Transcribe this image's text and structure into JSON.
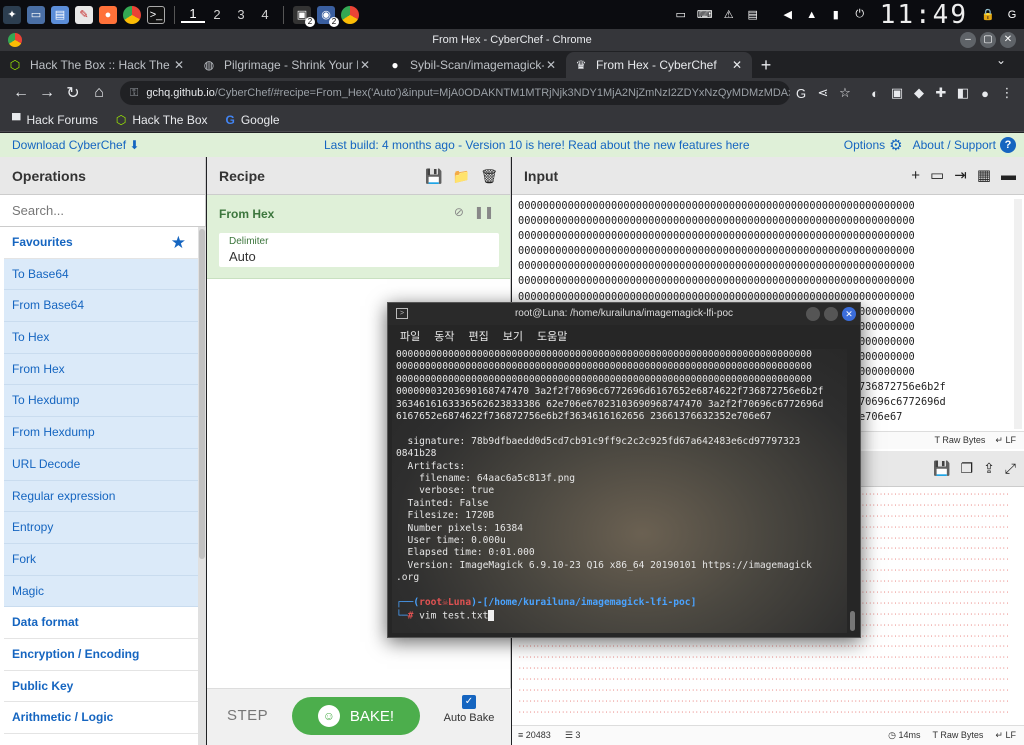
{
  "taskbar": {
    "workspaces": [
      "1",
      "2",
      "3",
      "4"
    ],
    "badge_count": "2",
    "clock": "11:49"
  },
  "window": {
    "title": "From Hex - CyberChef - Chrome"
  },
  "tabs": [
    {
      "label": "Hack The Box :: Hack The B"
    },
    {
      "label": "Pilgrimage - Shrink Your I"
    },
    {
      "label": "Sybil-Scan/imagemagick-l"
    },
    {
      "label": "From Hex - CyberChef"
    }
  ],
  "address": {
    "host": "gchq.github.io",
    "path": "/CyberChef/#recipe=From_Hex('Auto')&input=MjA0ODAKNTM1MTRjNjk3NDY1MjA2NjZmNzI2ZDYxNzQyMDMzMDAx..."
  },
  "bookmarks": [
    "Hack Forums",
    "Hack The Box",
    "Google"
  ],
  "banner": {
    "download": "Download CyberChef",
    "message": "Last build: 4 months ago - Version 10 is here! Read about the new features here",
    "options": "Options",
    "about": "About / Support"
  },
  "operations": {
    "title": "Operations",
    "search_placeholder": "Search...",
    "favourites": "Favourites",
    "favourite_items": [
      "To Base64",
      "From Base64",
      "To Hex",
      "From Hex",
      "To Hexdump",
      "From Hexdump",
      "URL Decode",
      "Regular expression",
      "Entropy",
      "Fork",
      "Magic"
    ],
    "categories": [
      "Data format",
      "Encryption / Encoding",
      "Public Key",
      "Arithmetic / Logic"
    ]
  },
  "recipe": {
    "title": "Recipe",
    "op_name": "From Hex",
    "arg_label": "Delimiter",
    "arg_value": "Auto",
    "step": "STEP",
    "bake": "BAKE!",
    "autobake": "Auto Bake"
  },
  "input": {
    "title": "Input",
    "lines": [
      "0000000000000000000000000000000000000000000000000000000000000000",
      "0000000000000000000000000000000000000000000000000000000000000000",
      "0000000000000000000000000000000000000000000000000000000000000000",
      "0000000000000000000000000000000000000000000000000000000000000000",
      "0000000000000000000000000000000000000000000000000000000000000000",
      "0000000000000000000000000000000000000000000000000000000000000000",
      "0000000000000000000000000000000000000000000000000000000000000000",
      "0000000000000000000000000000000000000000000000000000000000000000",
      "0000000000000000000000000000000000000000000000000000000000000000",
      "0000000000000000000000000000000000000000000000000000000000000000",
      "0000000000000000000000000000000000000000000000000000000000000000",
      "0000000000000000000000000000000000000000000000000000000000000000",
      "000000000000000000000000000000000000000000000000074622f736872756e6b2f",
      "00000000000000000000000000000000000000000000000002a2f2f70696c6772696d",
      "0000000000000000000000000000000000000000000000000062352e706e67"
    ],
    "status_raw": "Raw Bytes",
    "status_lf": "LF"
  },
  "output": {
    "status_chars": "20483",
    "status_lines": "3",
    "status_time": "14ms",
    "status_raw": "Raw Bytes",
    "status_lf": "LF"
  },
  "terminal": {
    "title": "root@Luna: /home/kurailuna/imagemagick-lfi-poc",
    "menu": [
      "파일",
      "동작",
      "편집",
      "보기",
      "도움말"
    ],
    "lines": [
      "000000000000000000000000000000000000000000000000000000000000000000000000",
      "000000000000000000000000000000000000000000000000000000000000000000000000",
      "000000000000000000000000000000000000000000000000000000000000000000000000",
      "00000003203690168747470 3a2f2f70696c6772696d6167652e6874622f736872756e6b2f",
      "3634616163336562623833386 62e706e67023103690968747470 3a2f2f70696c6772696d",
      "6167652e6874622f736872756e6b2f3634616162656 23661376632352e706e67",
      "",
      "  signature: 78b9dfbaedd0d5cd7cb91c9ff9c2c2c925fd67a642483e6cd97797323",
      "0841b28",
      "  Artifacts:",
      "    filename: 64aac6a5c813f.png",
      "    verbose: true",
      "  Tainted: False",
      "  Filesize: 1720B",
      "  Number pixels: 16384",
      "  User time: 0.000u",
      "  Elapsed time: 0:01.000",
      "  Version: ImageMagick 6.9.10-23 Q16 x86_64 20190101 https://imagemagick",
      ".org",
      ""
    ],
    "prompt_user": "root☠Luna",
    "prompt_path": "/home/kurailuna/imagemagick-lfi-poc",
    "prompt_cmd": "vim test.txt"
  }
}
